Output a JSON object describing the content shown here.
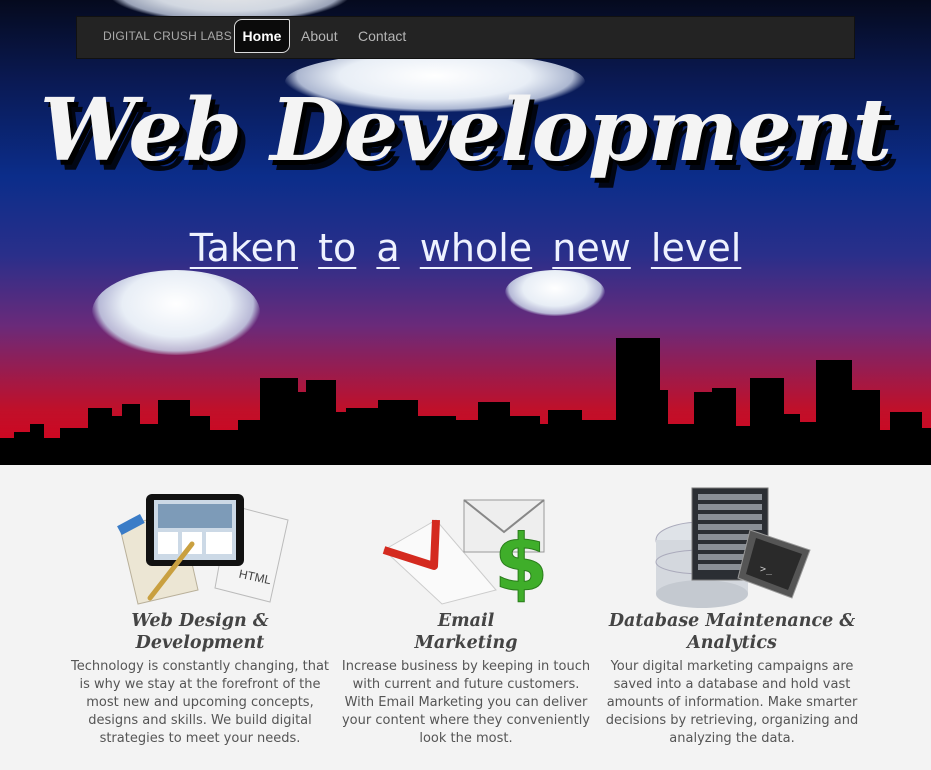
{
  "nav": {
    "brand": "DIGITAL CRUSH LABS",
    "items": [
      {
        "label": "Home",
        "active": true
      },
      {
        "label": "About",
        "active": false
      },
      {
        "label": "Contact",
        "active": false
      }
    ]
  },
  "hero": {
    "title": "Web Development",
    "subtitle_words": [
      "Taken",
      "to",
      "a",
      "whole",
      "new",
      "level"
    ]
  },
  "features": [
    {
      "icon": "web-design-tablet-icon",
      "title_line1": "Web Design &",
      "title_line2": "Development",
      "text": "Technology is constantly changing, that is why we stay at the forefront of the most new and upcoming concepts, designs and skills. We build digital strategies to meet your needs."
    },
    {
      "icon": "email-marketing-envelope-icon",
      "title_line1": "Email",
      "title_line2": "Marketing",
      "text": "Increase business by keeping in touch with current and future customers. With Email Marketing you can deliver your content where they conveniently look the most."
    },
    {
      "icon": "database-server-icon",
      "title_line1": "Database Maintenance &",
      "title_line2": "Analytics",
      "text": "Your digital marketing campaigns are saved into a database and hold vast amounts of information. Make smarter decisions by retrieving, organizing and analyzing the data."
    }
  ],
  "colors": {
    "nav_bg": "#232323",
    "hero_top": "#050a1e",
    "hero_mid": "#0b2d8a",
    "hero_bottom": "#d8001a",
    "content_bg": "#f3f3f3",
    "feature_title": "#444444",
    "feature_text": "#555555"
  }
}
